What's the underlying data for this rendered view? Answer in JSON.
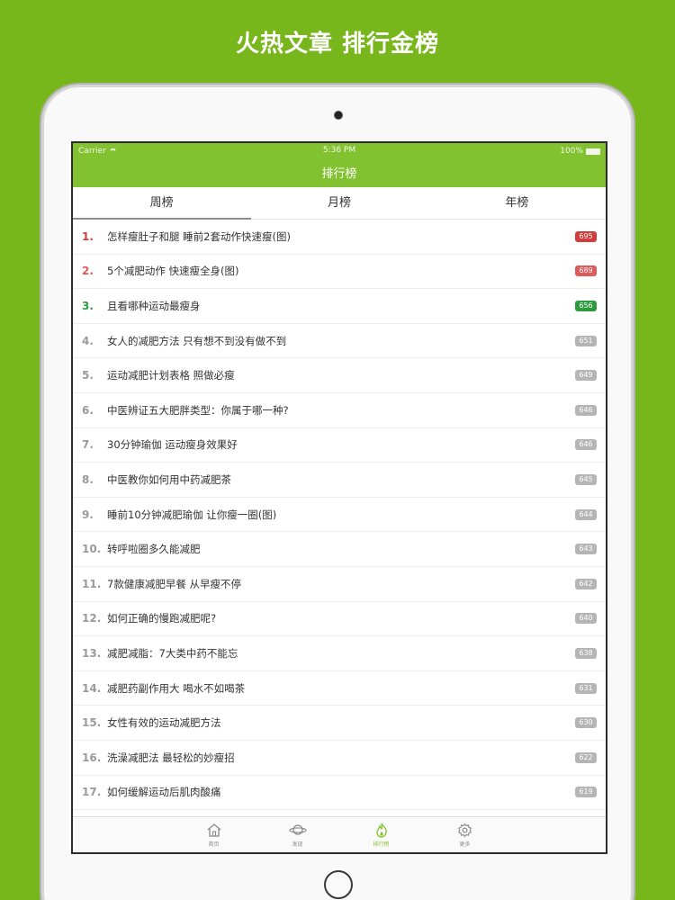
{
  "headline": "火热文章 排行金榜",
  "status": {
    "carrier": "Carrier",
    "time": "5:36 PM",
    "battery": "100%"
  },
  "nav": {
    "title": "排行榜"
  },
  "tabs": [
    {
      "label": "周榜"
    },
    {
      "label": "月榜"
    },
    {
      "label": "年榜"
    }
  ],
  "colors": {
    "brand": "#82c230",
    "background": "#77b71c",
    "rank1": "#d33c3c",
    "rank2": "#e05a5a",
    "rank3": "#2e9a3e"
  },
  "articles": [
    {
      "rank": "1.",
      "title": "怎样瘦肚子和腿 睡前2套动作快速瘦(图)",
      "count": "695"
    },
    {
      "rank": "2.",
      "title": "5个减肥动作 快速瘦全身(图)",
      "count": "689"
    },
    {
      "rank": "3.",
      "title": "且看哪种运动最瘦身",
      "count": "656"
    },
    {
      "rank": "4.",
      "title": "女人的减肥方法 只有想不到没有做不到",
      "count": "651"
    },
    {
      "rank": "5.",
      "title": "运动减肥计划表格 照做必瘦",
      "count": "649"
    },
    {
      "rank": "6.",
      "title": "中医辨证五大肥胖类型：你属于哪一种?",
      "count": "646"
    },
    {
      "rank": "7.",
      "title": "30分钟瑜伽 运动瘦身效果好",
      "count": "646"
    },
    {
      "rank": "8.",
      "title": "中医教你如何用中药减肥茶",
      "count": "645"
    },
    {
      "rank": "9.",
      "title": "睡前10分钟减肥瑜伽 让你瘦一圈(图)",
      "count": "644"
    },
    {
      "rank": "10.",
      "title": "转呼啦圈多久能减肥",
      "count": "643"
    },
    {
      "rank": "11.",
      "title": "7款健康减肥早餐 从早瘦不停",
      "count": "642"
    },
    {
      "rank": "12.",
      "title": "如何正确的慢跑减肥呢?",
      "count": "640"
    },
    {
      "rank": "13.",
      "title": "减肥减脂：7大类中药不能忘",
      "count": "638"
    },
    {
      "rank": "14.",
      "title": "减肥药副作用大 喝水不如喝茶",
      "count": "631"
    },
    {
      "rank": "15.",
      "title": "女性有效的运动减肥方法",
      "count": "630"
    },
    {
      "rank": "16.",
      "title": "洗澡减肥法 最轻松的妙瘦招",
      "count": "622"
    },
    {
      "rank": "17.",
      "title": "如何缓解运动后肌肉酸痛",
      "count": "619"
    }
  ],
  "tabbar": [
    {
      "label": "首页",
      "icon": "home-icon"
    },
    {
      "label": "发现",
      "icon": "planet-icon"
    },
    {
      "label": "排行榜",
      "icon": "flame-icon"
    },
    {
      "label": "更多",
      "icon": "gear-icon"
    }
  ]
}
